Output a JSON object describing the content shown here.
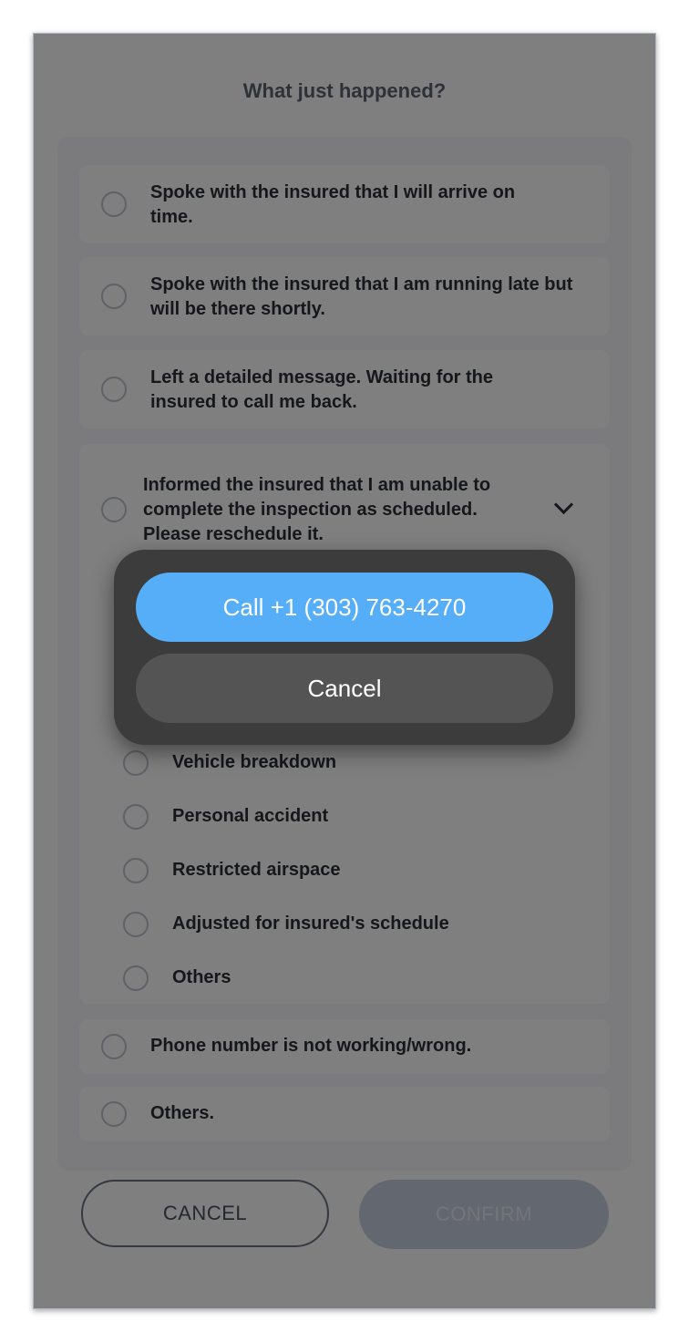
{
  "dialog": {
    "title": "What just happened?"
  },
  "options": [
    {
      "label": "Spoke with the insured that I will arrive on time."
    },
    {
      "label": "Spoke with the insured that I am running late but will be there shortly."
    },
    {
      "label": "Left a detailed message. Waiting for the insured to call me back."
    },
    {
      "label": "Informed the insured that I am unable to complete the inspection as scheduled. Please reschedule it."
    },
    {
      "label": "Phone number is not working/wrong."
    },
    {
      "label": "Others."
    }
  ],
  "reasons": [
    {
      "label": "Vehicle breakdown"
    },
    {
      "label": "Personal accident"
    },
    {
      "label": "Restricted airspace"
    },
    {
      "label": "Adjusted for insured's schedule"
    },
    {
      "label": "Others"
    }
  ],
  "footer": {
    "cancel_label": "CANCEL",
    "confirm_label": "CONFIRM"
  },
  "call_sheet": {
    "call_label": "Call +1 (303) 763-4270",
    "cancel_label": "Cancel"
  },
  "colors": {
    "accent": "#56adf8",
    "overlay": "rgba(0,0,0,0.50)",
    "sheet": "#3c3c3c"
  },
  "icons": {
    "expand": "chevron-down-icon"
  }
}
